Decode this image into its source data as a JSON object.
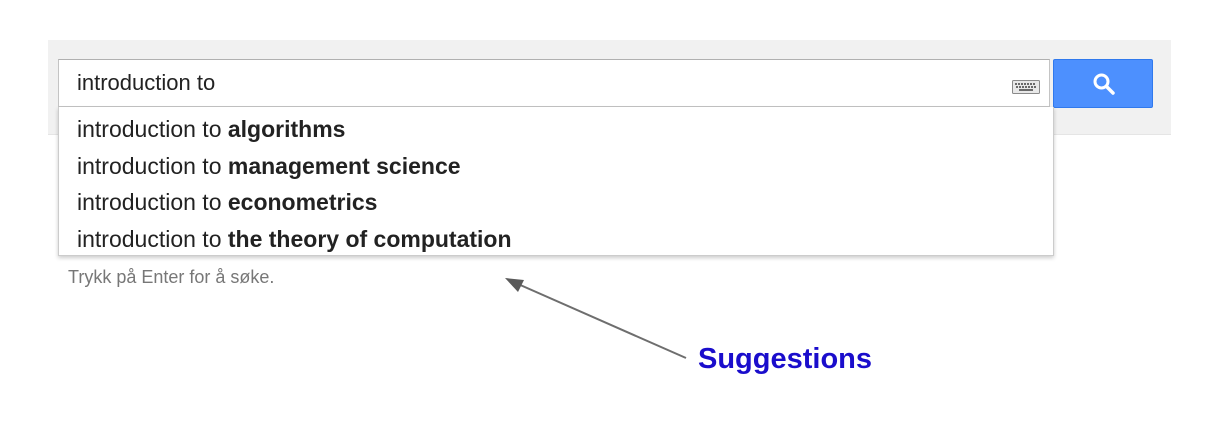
{
  "search": {
    "query": "introduction to",
    "keyboard_icon": "keyboard-icon",
    "button_icon": "search-icon"
  },
  "suggestions": [
    {
      "prefix": "introduction to ",
      "completion": "algorithms"
    },
    {
      "prefix": "introduction to ",
      "completion": "management science"
    },
    {
      "prefix": "introduction to ",
      "completion": "econometrics"
    },
    {
      "prefix": "introduction to ",
      "completion": "the theory of computation"
    }
  ],
  "hint": "Trykk på Enter for å søke.",
  "annotation": {
    "label": "Suggestions",
    "color": "#1a0dcc"
  },
  "colors": {
    "button": "#4d90fe",
    "topbar": "#f1f1f1"
  }
}
